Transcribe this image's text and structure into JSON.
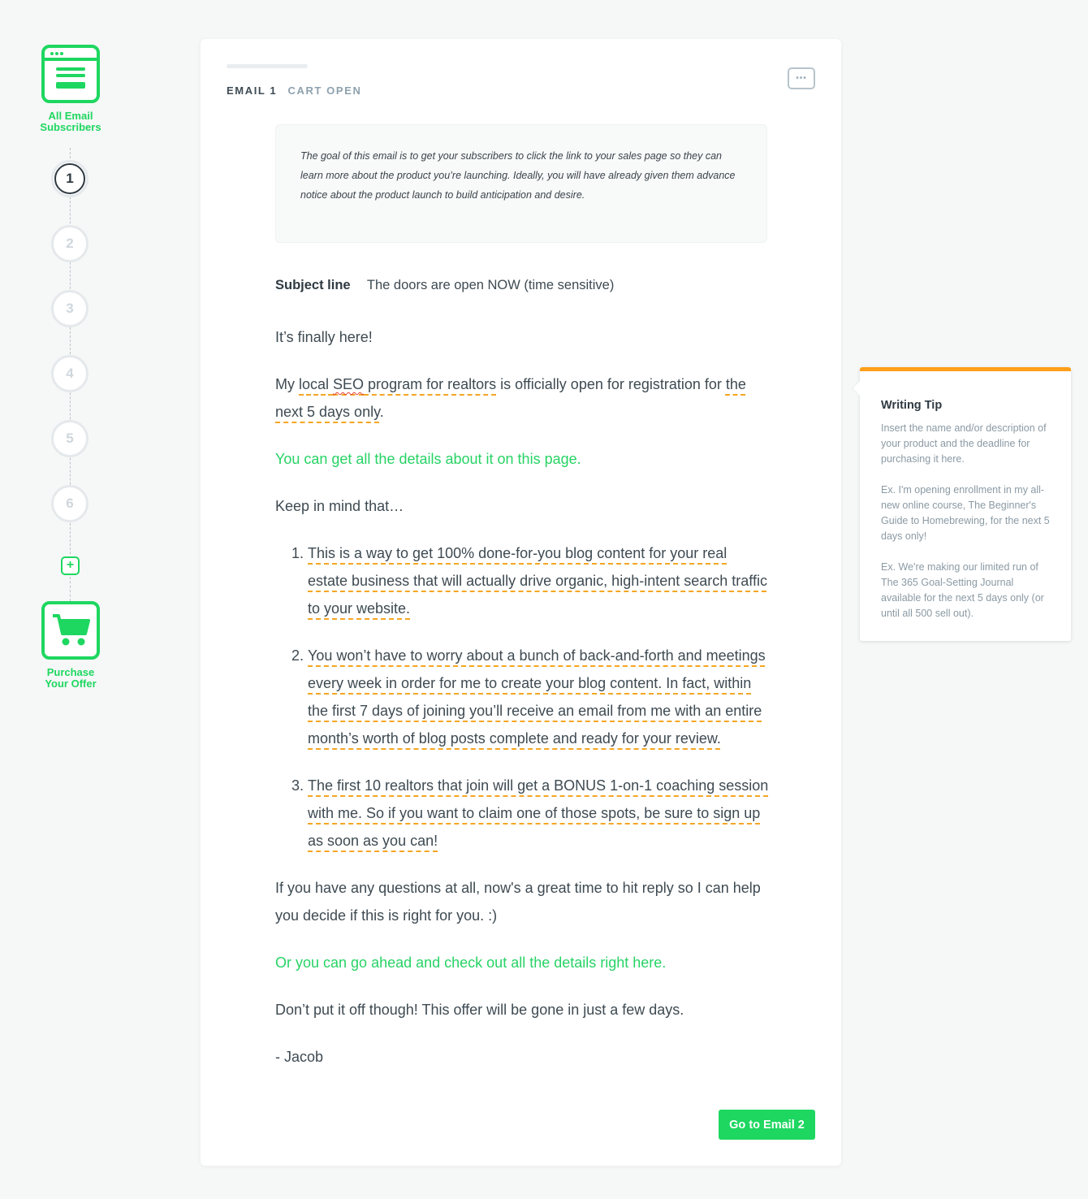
{
  "rail": {
    "start_node": {
      "label_line1": "All Email",
      "label_line2": "Subscribers",
      "icon": "browser-window-icon"
    },
    "steps": [
      {
        "number": "1",
        "active": true
      },
      {
        "number": "2",
        "active": false
      },
      {
        "number": "3",
        "active": false
      },
      {
        "number": "4",
        "active": false
      },
      {
        "number": "5",
        "active": false
      },
      {
        "number": "6",
        "active": false
      }
    ],
    "add_step_symbol": "+",
    "end_node": {
      "label_line1": "Purchase",
      "label_line2": "Your Offer",
      "icon": "shopping-cart-icon"
    }
  },
  "email": {
    "number_label": "EMAIL 1",
    "name_label": "CART OPEN",
    "more_symbol": "•••",
    "goal_text": "The goal of this email is to get your subscribers to click the link to your sales page so they can learn more about the product you’re launching. Ideally, you will have already given them advance notice about the product launch to build anticipation and desire.",
    "subject_label": "Subject line",
    "subject_value": "The doors are open NOW (time sensitive)",
    "body": {
      "p1": "It’s finally here!",
      "p2_before": "My ",
      "p2_hl_a": "local ",
      "p2_hl_spell": "SEO",
      "p2_hl_b": " program for realtors",
      "p2_mid": " is officially open for registration for ",
      "p2_hl_c": "the next 5 days only",
      "p2_end": ".",
      "link1": "You can get all the details about it on this page.",
      "p3": "Keep in mind that…",
      "list": [
        "This is a way to get 100% done-for-you blog content for your real estate business that will actually drive organic, high-intent search traffic to your website.",
        "You won’t have to worry about a bunch of back-and-forth and meetings every week in order for me to create your blog content. In fact, within the first 7 days of joining you’ll receive an email from me with an entire month’s worth of blog posts complete and ready for your review.",
        "The first 10 realtors that join will get a BONUS 1-on-1 coaching session with me. So if you want to claim one of those spots, be sure to sign up as soon as you can!"
      ],
      "p4": "If you have any questions at all, now's a great time to hit reply so I can help you decide if this is right for you. :)",
      "link2": "Or you can go ahead and check out all the details right here.",
      "p5": "Don’t put it off though! This offer will be gone in just a few days.",
      "signature": "- Jacob"
    },
    "next_button_label": "Go to Email 2"
  },
  "writing_tip": {
    "title": "Writing Tip",
    "paragraphs": [
      " Insert the name and/or description of your product and the deadline for purchasing it here.",
      "Ex. I'm opening enrollment in my all-new online course, The Beginner's Guide to Homebrewing, for the next 5 days only!",
      "Ex. We're making our limited run of The 365 Goal-Setting Journal available for the next 5 days only (or until all 500 sell out)."
    ]
  },
  "colors": {
    "brand_green": "#1ed760",
    "link_green": "#27d365",
    "highlight_orange": "#f5a623",
    "tip_accent": "#ff9f1a"
  }
}
